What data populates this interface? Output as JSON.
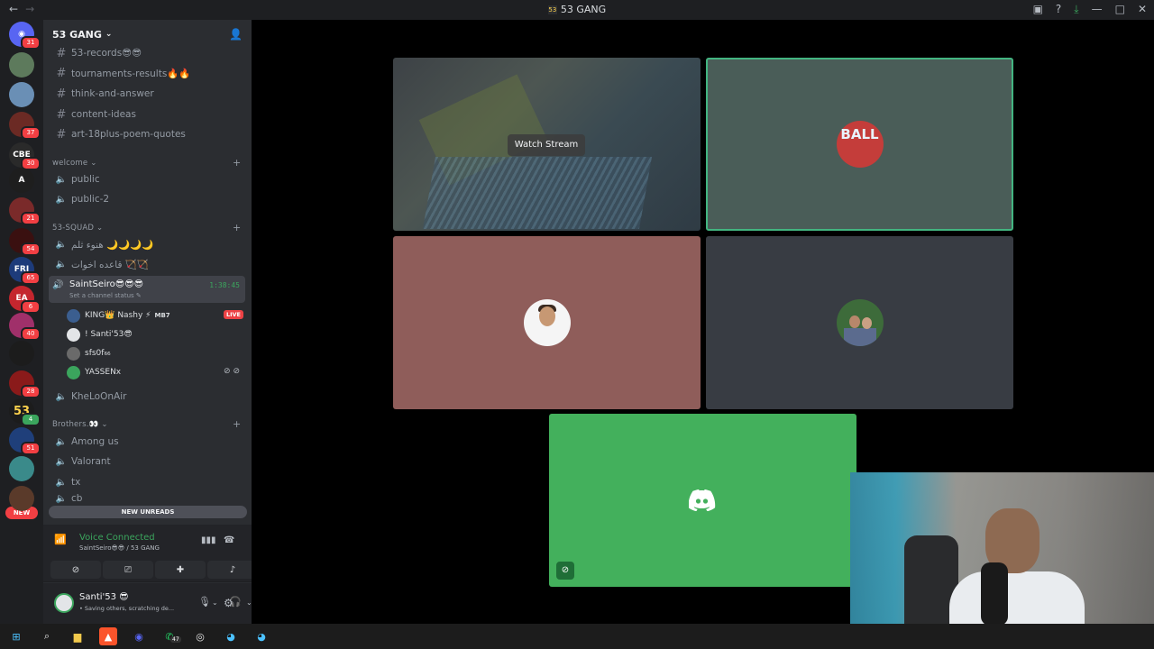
{
  "titlebar": {
    "title": "53 GANG",
    "server_tag": "53"
  },
  "rail": {
    "new_label": "NEW",
    "servers": [
      {
        "name": "discord-home",
        "badge": "31",
        "color": "#5865f2",
        "glyph": "◉"
      },
      {
        "name": "server-2",
        "badge": "",
        "color": "#5d7a5c",
        "glyph": ""
      },
      {
        "name": "server-3",
        "badge": "",
        "color": "#6a8fb5",
        "glyph": ""
      },
      {
        "name": "server-4",
        "badge": "37",
        "color": "#6b2a24",
        "glyph": ""
      },
      {
        "name": "server-5",
        "badge": "30",
        "color": "#2a2a2a",
        "glyph": "CBE"
      },
      {
        "name": "server-6",
        "badge": "",
        "color": "#1e1e1e",
        "glyph": "A"
      },
      {
        "name": "server-7",
        "badge": "21",
        "color": "#7a2a2a",
        "glyph": ""
      },
      {
        "name": "server-8",
        "badge": "54",
        "color": "#3a1010",
        "glyph": ""
      },
      {
        "name": "server-9",
        "badge": "65",
        "color": "#1d3b7a",
        "glyph": "FRI"
      },
      {
        "name": "server-10",
        "badge": "6",
        "color": "#c4262e",
        "glyph": "EA"
      },
      {
        "name": "server-11",
        "badge": "40",
        "color": "#a0306a",
        "glyph": ""
      },
      {
        "name": "server-12",
        "badge": "",
        "color": "#1c1c1c",
        "glyph": ""
      },
      {
        "name": "server-13",
        "badge": "28",
        "color": "#8a1a1a",
        "glyph": ""
      },
      {
        "name": "server-53",
        "badge": "4",
        "color": "#1c1c1c",
        "glyph": "53"
      },
      {
        "name": "server-15",
        "badge": "51",
        "color": "#1f3f7a",
        "glyph": ""
      },
      {
        "name": "server-16",
        "badge": "",
        "color": "#3a8a8a",
        "glyph": ""
      },
      {
        "name": "server-17",
        "badge": "",
        "color": "#5a3a2a",
        "glyph": ""
      }
    ]
  },
  "sidebar": {
    "server_name": "53 GANG",
    "text_channels": [
      {
        "label": "53-records😎😎"
      },
      {
        "label": "tournaments-results🔥🔥"
      },
      {
        "label": "think-and-answer"
      },
      {
        "label": "content-ideas"
      },
      {
        "label": "art-18plus-poem-quotes"
      }
    ],
    "categories": {
      "welcome": "welcome",
      "squad": "53-SQUAD",
      "brothers": "Brothers.👀"
    },
    "welcome_channels": [
      {
        "label": "public"
      },
      {
        "label": "public-2"
      }
    ],
    "squad_channels": [
      {
        "label": "هنوء ثلم 🌙🌙🌙🌙"
      },
      {
        "label": "قاعده اخوات 🏹🏹"
      }
    ],
    "active_channel": {
      "name": "SaintSeiro😎😎😎",
      "status": "Set a channel status ✎",
      "timer": "1:38:45"
    },
    "voice_users": [
      {
        "name": "KING👑 Nashy ⚡",
        "tag": "MB7",
        "live": "LIVE",
        "color": "#3b5e8f"
      },
      {
        "name": "! Santi'53😎",
        "tag": "",
        "live": "",
        "color": "#e3e5e8"
      },
      {
        "name": "sfs0f₆₆",
        "tag": "",
        "live": "",
        "color": "#6a6a6a"
      },
      {
        "name": "YASSENx",
        "tag": "",
        "live": "",
        "color": "#3ba55d"
      }
    ],
    "other_channels": [
      {
        "label": "KheLoOnAir"
      }
    ],
    "brothers_channels": [
      {
        "label": "Among us"
      },
      {
        "label": "Valorant"
      },
      {
        "label": "tx"
      },
      {
        "label": "cb"
      }
    ],
    "new_unreads": "NEW UNREADS"
  },
  "voice": {
    "status": "Voice Connected",
    "location": "SaintSeiro😎😎 / 53 GANG"
  },
  "user": {
    "name": "Santi'53 😎",
    "status": "• Saving others, scratching de..."
  },
  "stage": {
    "watch_stream": "Watch Stream",
    "tile2_avatar_text": "BALL"
  },
  "taskbar": {
    "whatsapp_badge": "47"
  }
}
